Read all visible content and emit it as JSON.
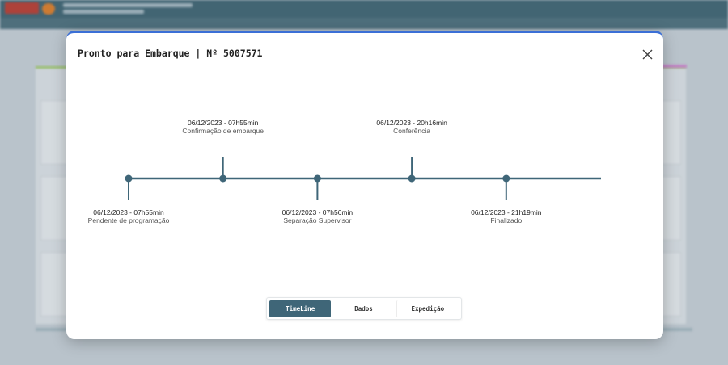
{
  "modal": {
    "title": "Pronto para Embarque | Nº 5007571"
  },
  "timeline": {
    "events": [
      {
        "date": "06/12/2023 - 07h55min",
        "label": "Pendente de programação",
        "position": "below"
      },
      {
        "date": "06/12/2023 - 07h55min",
        "label": "Confirmação de embarque",
        "position": "above"
      },
      {
        "date": "06/12/2023 - 07h56min",
        "label": "Separação Supervisor",
        "position": "below"
      },
      {
        "date": "06/12/2023 - 20h16min",
        "label": "Conferência",
        "position": "above"
      },
      {
        "date": "06/12/2023 - 21h19min",
        "label": "Finalizado",
        "position": "below"
      }
    ],
    "color": "#3f6678"
  },
  "tabs": [
    {
      "label": "TimeLine",
      "active": true
    },
    {
      "label": "Dados",
      "active": false
    },
    {
      "label": "Expedição",
      "active": false
    }
  ],
  "icons": {
    "close": "close-icon"
  }
}
